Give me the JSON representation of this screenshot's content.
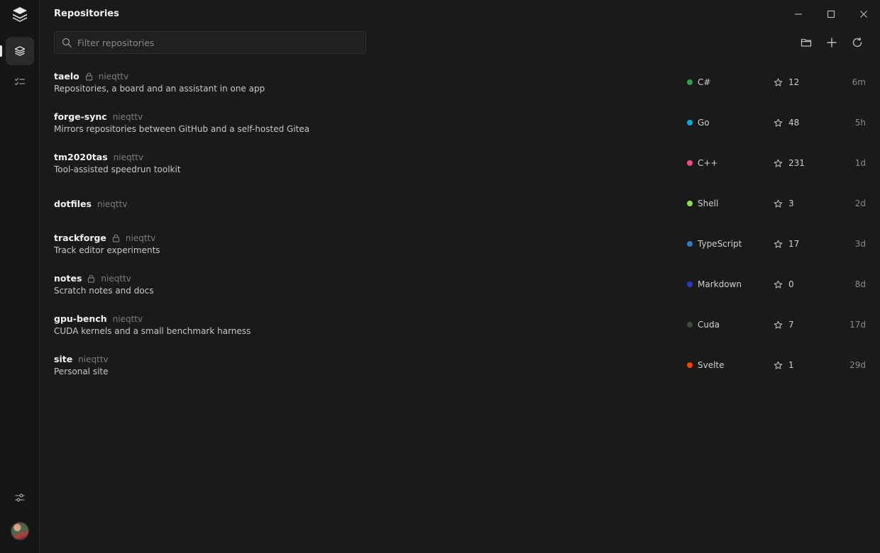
{
  "window": {
    "title": "Repositories"
  },
  "search": {
    "placeholder": "Filter repositories"
  },
  "repos": [
    {
      "name": "taelo",
      "private": true,
      "owner": "nieqttv",
      "description": "Repositories, a board and an assistant in one app",
      "language": "C#",
      "lang_color": "#2ea043",
      "stars": "12",
      "updated": "6m"
    },
    {
      "name": "forge-sync",
      "private": false,
      "owner": "nieqttv",
      "description": "Mirrors repositories between GitHub and a self-hosted Gitea",
      "language": "Go",
      "lang_color": "#00add8",
      "stars": "48",
      "updated": "5h"
    },
    {
      "name": "tm2020tas",
      "private": false,
      "owner": "nieqttv",
      "description": "Tool-assisted speedrun toolkit",
      "language": "C++",
      "lang_color": "#f34b7d",
      "stars": "231",
      "updated": "1d"
    },
    {
      "name": "dotfiles",
      "private": false,
      "owner": "nieqttv",
      "description": "",
      "language": "Shell",
      "lang_color": "#89e051",
      "stars": "3",
      "updated": "2d"
    },
    {
      "name": "trackforge",
      "private": true,
      "owner": "nieqttv",
      "description": "Track editor experiments",
      "language": "TypeScript",
      "lang_color": "#3178c6",
      "stars": "17",
      "updated": "3d"
    },
    {
      "name": "notes",
      "private": true,
      "owner": "nieqttv",
      "description": "Scratch notes and docs",
      "language": "Markdown",
      "lang_color": "#1f3fbf",
      "stars": "0",
      "updated": "8d"
    },
    {
      "name": "gpu-bench",
      "private": false,
      "owner": "nieqttv",
      "description": "CUDA kernels and a small benchmark harness",
      "language": "Cuda",
      "lang_color": "#3a4e3a",
      "stars": "7",
      "updated": "17d"
    },
    {
      "name": "site",
      "private": false,
      "owner": "nieqttv",
      "description": "Personal site",
      "language": "Svelte",
      "lang_color": "#ff3e00",
      "stars": "1",
      "updated": "29d"
    }
  ]
}
